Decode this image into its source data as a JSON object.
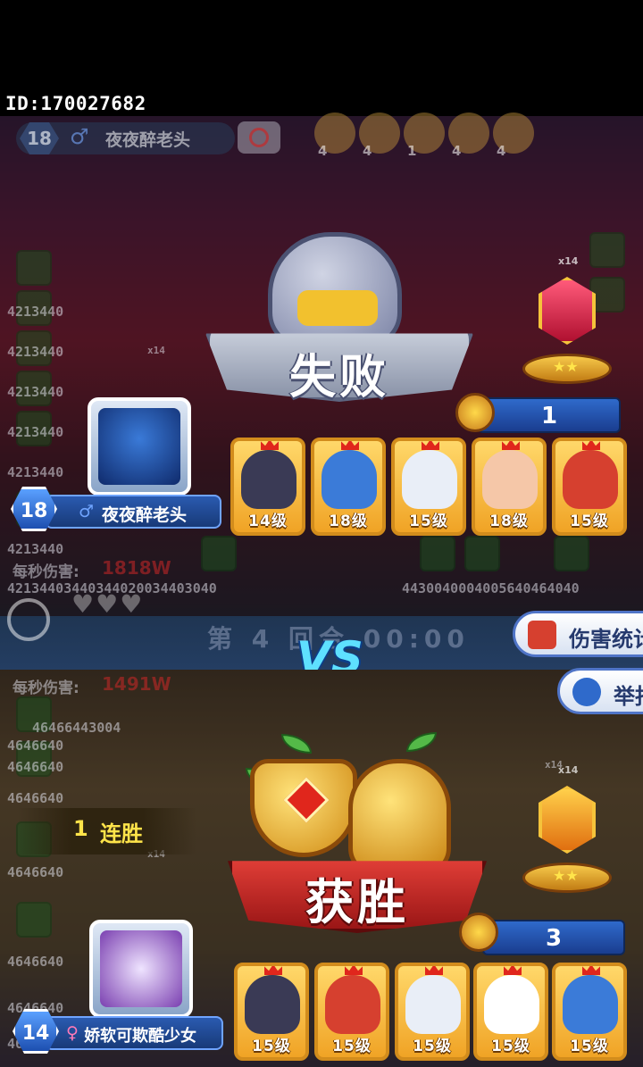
{
  "header": {
    "id_text": "ID:170027682"
  },
  "opponent_strip": {
    "level": "18",
    "name": "夜夜醉老头",
    "mini_heroes": [
      {
        "stars": "4"
      },
      {
        "stars": "4"
      },
      {
        "stars": "1"
      },
      {
        "stars": "4"
      },
      {
        "stars": "4"
      }
    ]
  },
  "background_numbers": {
    "top": [
      "4213440",
      "4213440",
      "4213440",
      "4213440",
      "4213440",
      "4213440"
    ],
    "top_row": "42134403440344020034403040",
    "top_row_right": "4430040004005640464040",
    "bottom": [
      "46466443004",
      "4646640",
      "4646640",
      "4646640",
      "4646640",
      "4646640",
      "4646640",
      "4646640"
    ],
    "dps_top_label": "每秒伤害:",
    "dps_top_value": "1818W",
    "dps_bottom_label": "每秒伤害:",
    "dps_bottom_value": "1491W",
    "x14_a": "x14",
    "x14_b": "x14",
    "x14_c": "x14",
    "x14_d": "x14"
  },
  "loser": {
    "result": "失败",
    "score": "1",
    "trophy_mult": "x14",
    "trophy_stars": "★★",
    "gender_symbol": "♂",
    "name": "夜夜醉老头",
    "level": "18",
    "heroes": [
      {
        "level": "14级",
        "color": "#3a3a55"
      },
      {
        "level": "18级",
        "color": "#3b7bd8"
      },
      {
        "level": "15级",
        "color": "#e9eef7"
      },
      {
        "level": "18级",
        "color": "#f5c7a8"
      },
      {
        "level": "15级",
        "color": "#d6402f"
      }
    ]
  },
  "round": {
    "text": "第 4 回合 00:00"
  },
  "vs": "VS",
  "side_buttons": {
    "damage_stats": "伤害统计",
    "report": "举报"
  },
  "winner": {
    "result": "获胜",
    "streak_num": "1",
    "streak_label": "连胜",
    "score": "3",
    "trophy_mult": "x14",
    "trophy_stars": "★★",
    "gender_symbol": "♀",
    "name": "娇软可欺酷少女",
    "level": "14",
    "heroes": [
      {
        "level": "15级",
        "color": "#3a3a55"
      },
      {
        "level": "15级",
        "color": "#d6402f"
      },
      {
        "level": "15级",
        "color": "#e9eef7"
      },
      {
        "level": "15级",
        "color": "#ffffff"
      },
      {
        "level": "15级",
        "color": "#3b7bd8"
      }
    ]
  },
  "colors": {
    "accent_blue": "#2f6acb",
    "gold": "#f0a325",
    "win_red": "#e8423a",
    "vs_cyan": "#5ee0ff"
  }
}
